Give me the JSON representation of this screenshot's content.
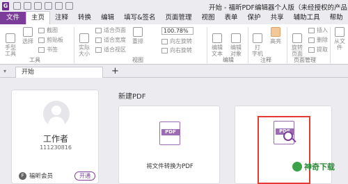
{
  "titlebar": {
    "title": "开始 - 福昕PDF编辑器个人版（未经授权的产品"
  },
  "ribbon_tabs": [
    "文件",
    "主页",
    "注释",
    "转换",
    "编辑",
    "填写&签名",
    "页面管理",
    "视图",
    "表单",
    "保护",
    "共享",
    "辅助工具",
    "帮助"
  ],
  "ribbon": {
    "tools": {
      "hand": "手型\n工具",
      "select": "选择",
      "actual_size": "实际\n大小",
      "rotate": "重排",
      "edit_text": "编辑\n文本",
      "edit_object": "编辑\n对象",
      "typewriter": "打\n字机",
      "highlight": "高亮",
      "rotate_page": "旋转\n页面",
      "from_file": "从文件"
    },
    "small_tools": {
      "snapshot": "截图",
      "clipboard": "剪贴板",
      "bookmark": "书签",
      "fit_page": "适合页面",
      "fit_width": "适合宽度",
      "fit_visible": "适合视区",
      "rotate_left": "向左旋转",
      "rotate_right": "向右旋转",
      "insert": "插入",
      "delete": "删除",
      "extract": "提取"
    },
    "zoom": "100.78%",
    "groups": {
      "tools": "工具",
      "view": "视图",
      "edit": "编辑",
      "comment": "注释",
      "page_mgmt": "页面管理"
    }
  },
  "doc_tabs": {
    "start_tab": "开始",
    "add": "+"
  },
  "user_card": {
    "name": "工作者",
    "id": "111230816",
    "member_label": "福昕会员",
    "open_button": "开通",
    "member_badge": "F"
  },
  "create": {
    "section_title": "新建PDF",
    "from_file_label": "将文件转换为PDF",
    "pdf_badge": "PDF"
  },
  "watermark": {
    "text": "神奇下载"
  }
}
